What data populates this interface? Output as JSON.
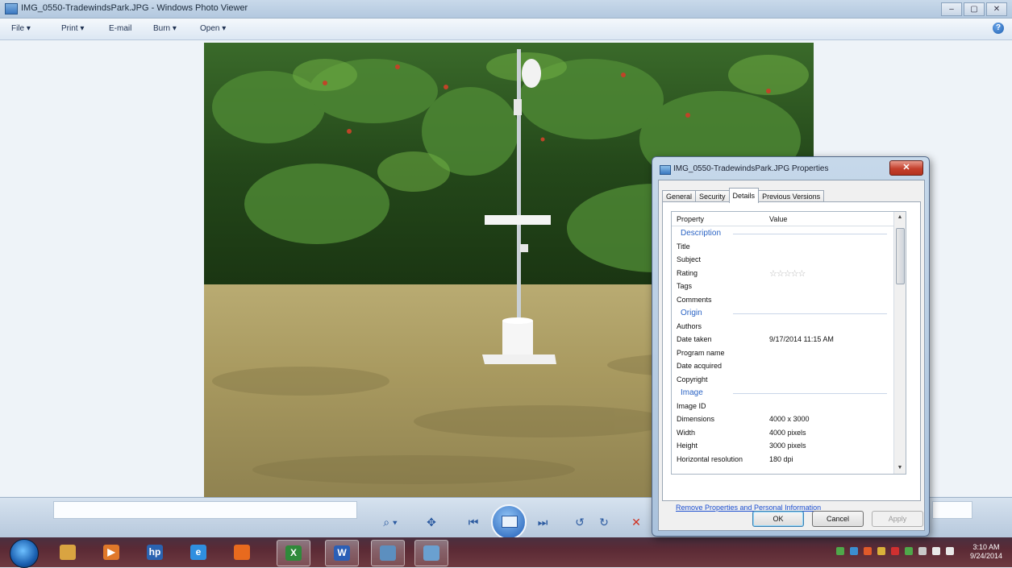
{
  "window": {
    "title": "IMG_0550-TradewindsPark.JPG - Windows Photo Viewer",
    "controls": [
      "–",
      "▢",
      "✕"
    ]
  },
  "menu": {
    "items": [
      "File  ▾",
      "Print  ▾",
      "E-mail",
      "Burn  ▾",
      "Open  ▾"
    ],
    "help": "?"
  },
  "controlbar": {
    "zoom": "⌕ ▾",
    "fit": "✥",
    "prev": "⏮",
    "next": "⏭",
    "rotate_ccw": "↺",
    "rotate_cw": "↻",
    "delete": "✕"
  },
  "taskbar": {
    "apps": [
      {
        "name": "explorer",
        "glyph": "",
        "color": "#d9a441"
      },
      {
        "name": "media",
        "glyph": "▶",
        "color": "#e0782a"
      },
      {
        "name": "hp",
        "glyph": "hp",
        "color": "#2a63b0"
      },
      {
        "name": "ie",
        "glyph": "e",
        "color": "#2f8fe0"
      },
      {
        "name": "firefox",
        "glyph": "",
        "color": "#e86a1e"
      },
      {
        "name": "excel",
        "glyph": "X",
        "color": "#2f8a3a"
      },
      {
        "name": "word",
        "glyph": "W",
        "color": "#2b5fb6"
      },
      {
        "name": "photos",
        "glyph": "",
        "color": "#5c8fbf"
      },
      {
        "name": "photo-viewer",
        "glyph": "",
        "color": "#6aa0d0"
      }
    ],
    "clock_time": "3:10 AM",
    "clock_date": "9/24/2014"
  },
  "dialog": {
    "title": "IMG_0550-TradewindsPark.JPG Properties",
    "close": "✕",
    "tabs": [
      "General",
      "Security",
      "Details",
      "Previous Versions"
    ],
    "selected_tab": "Details",
    "header_property": "Property",
    "header_value": "Value",
    "rows": [
      {
        "type": "section",
        "prop": "Description"
      },
      {
        "prop": "Title",
        "val": ""
      },
      {
        "prop": "Subject",
        "val": ""
      },
      {
        "prop": "Rating",
        "val": "",
        "stars": "☆☆☆☆☆"
      },
      {
        "prop": "Tags",
        "val": ""
      },
      {
        "prop": "Comments",
        "val": ""
      },
      {
        "type": "section",
        "prop": "Origin"
      },
      {
        "prop": "Authors",
        "val": ""
      },
      {
        "prop": "Date taken",
        "val": "9/17/2014 11:15 AM"
      },
      {
        "prop": "Program name",
        "val": ""
      },
      {
        "prop": "Date acquired",
        "val": ""
      },
      {
        "prop": "Copyright",
        "val": ""
      },
      {
        "type": "section",
        "prop": "Image"
      },
      {
        "prop": "Image ID",
        "val": ""
      },
      {
        "prop": "Dimensions",
        "val": "4000 x 3000"
      },
      {
        "prop": "Width",
        "val": "4000 pixels"
      },
      {
        "prop": "Height",
        "val": "3000 pixels"
      },
      {
        "prop": "Horizontal resolution",
        "val": "180 dpi"
      }
    ],
    "remove_link": "Remove Properties and Personal Information",
    "ok": "OK",
    "cancel": "Cancel",
    "apply": "Apply"
  }
}
